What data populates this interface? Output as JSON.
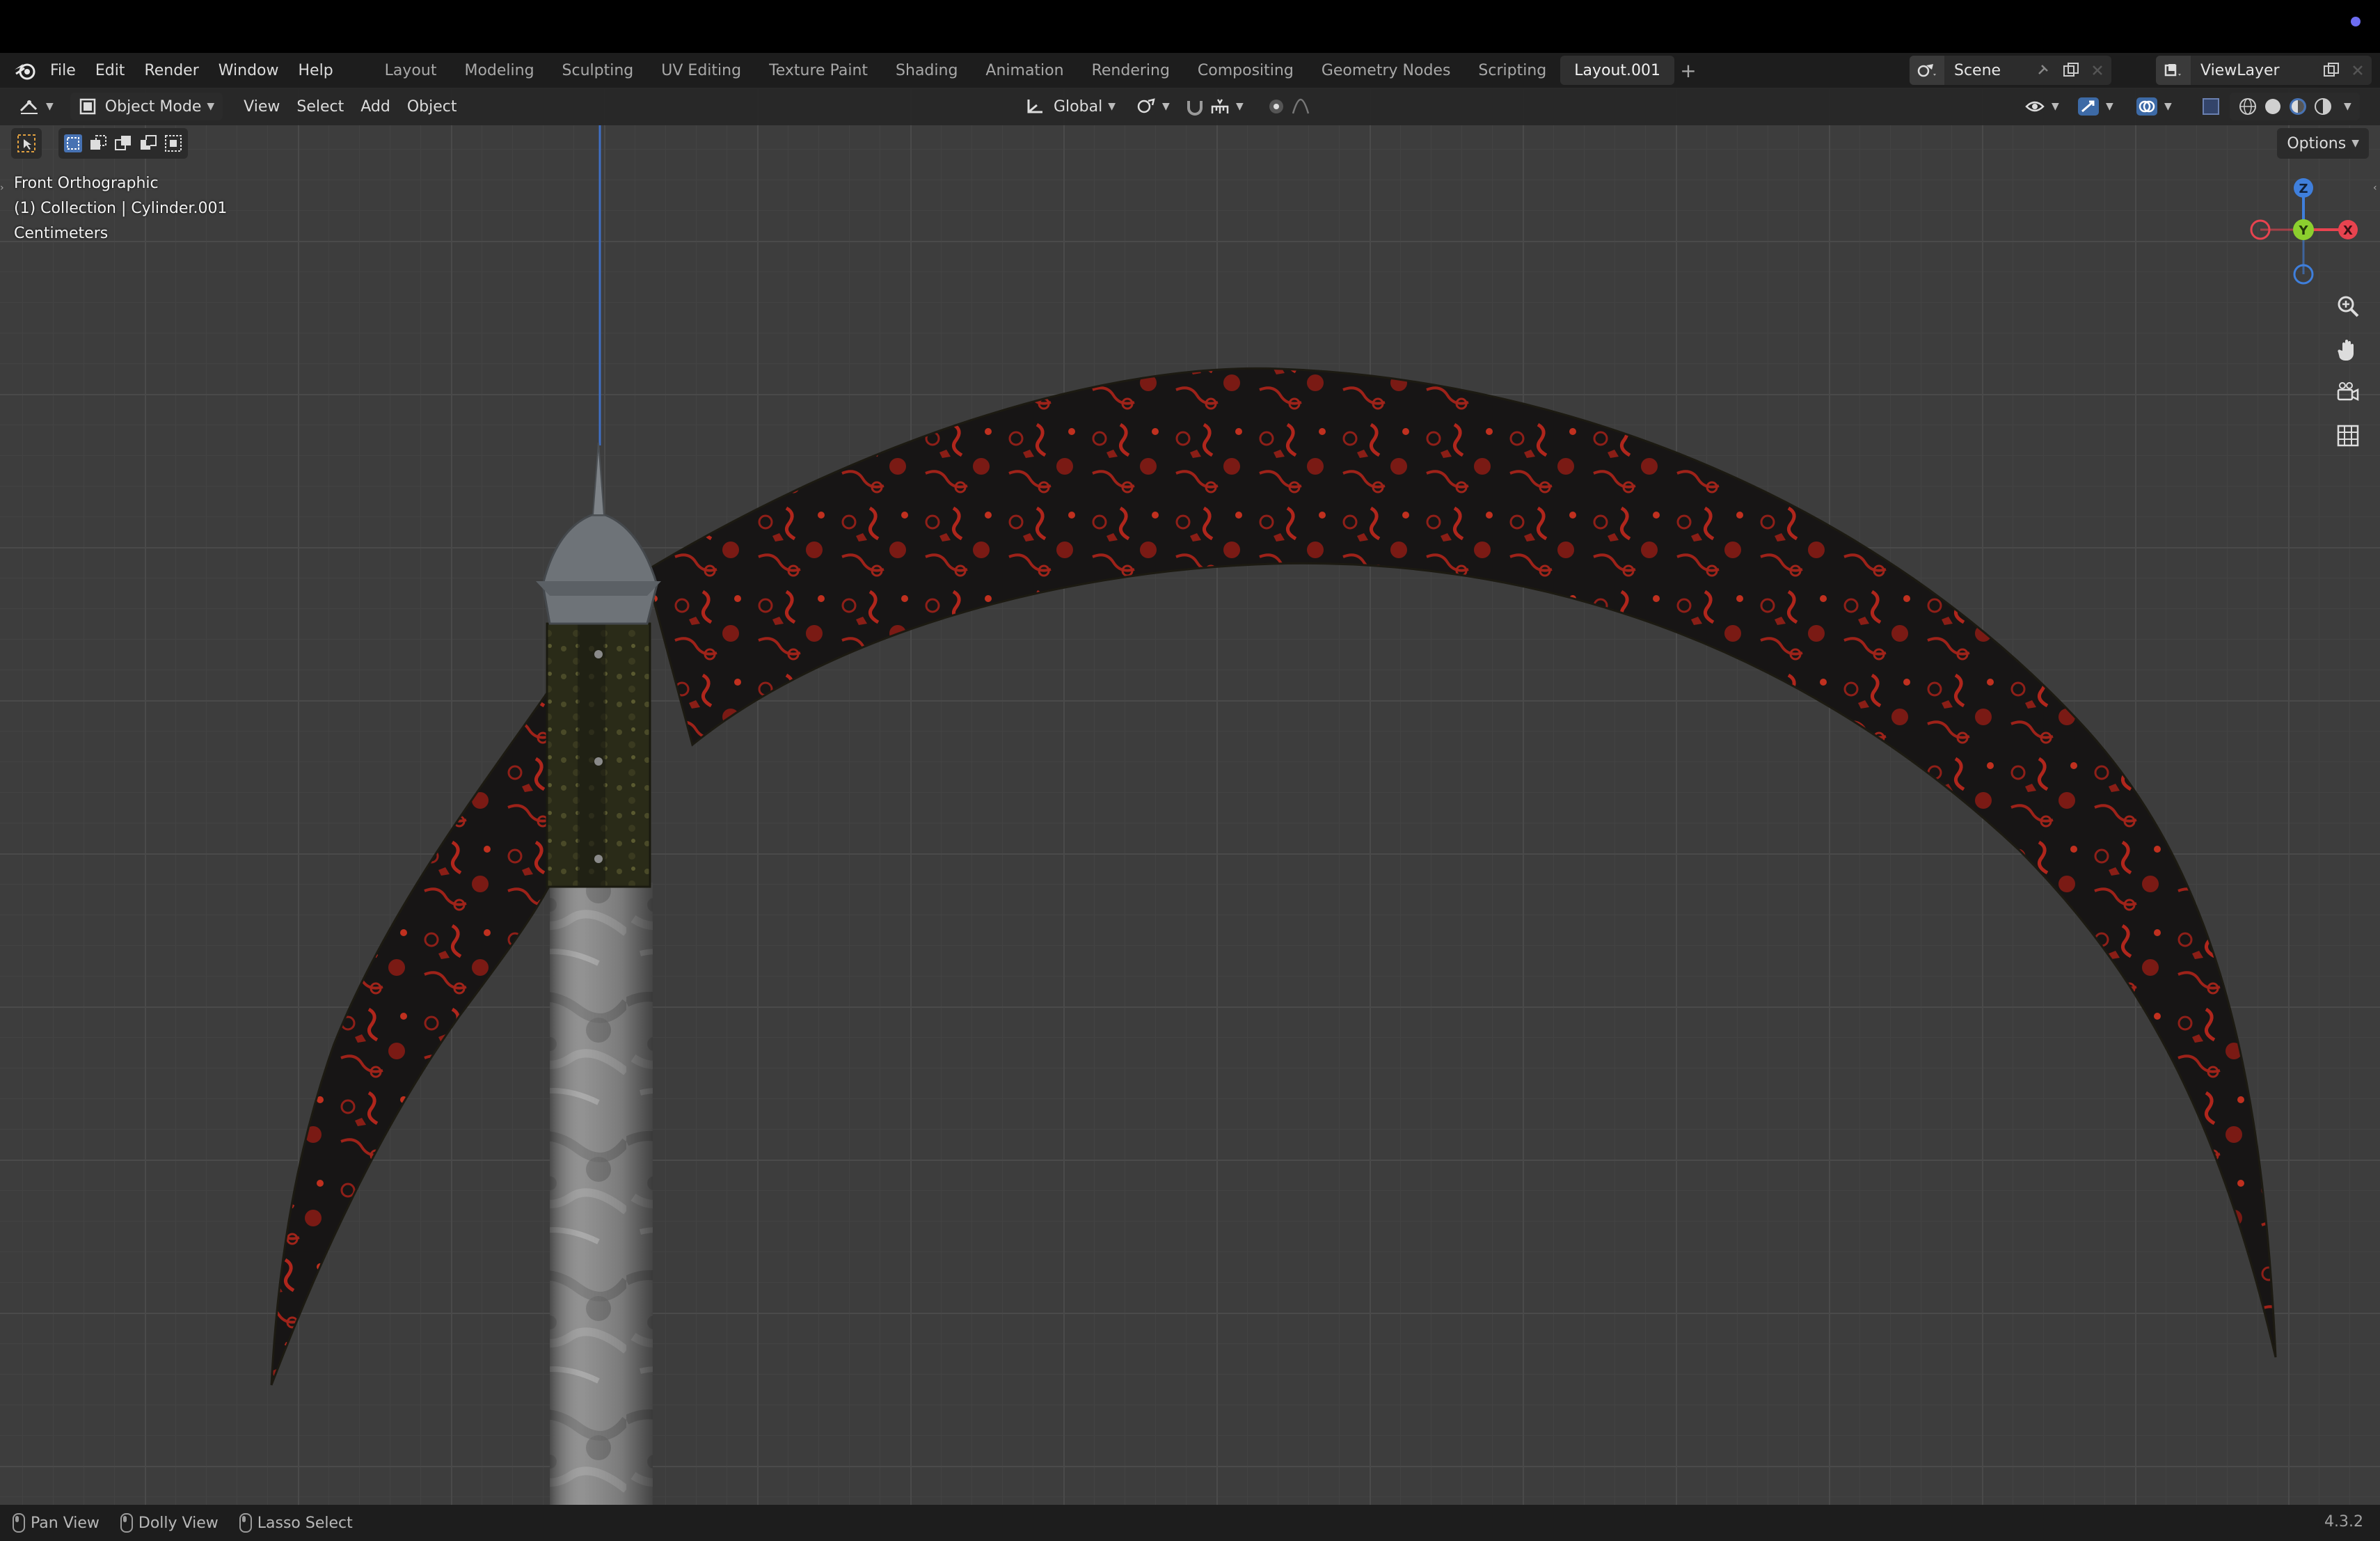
{
  "menu": {
    "file": "File",
    "edit": "Edit",
    "render": "Render",
    "window": "Window",
    "help": "Help"
  },
  "workspaces": [
    "Layout",
    "Modeling",
    "Sculpting",
    "UV Editing",
    "Texture Paint",
    "Shading",
    "Animation",
    "Rendering",
    "Compositing",
    "Geometry Nodes",
    "Scripting",
    "Layout.001"
  ],
  "active_workspace": "Layout.001",
  "scene": {
    "name": "Scene"
  },
  "view_layer": {
    "name": "ViewLayer"
  },
  "header": {
    "mode": "Object Mode",
    "view": "View",
    "select": "Select",
    "add": "Add",
    "object": "Object",
    "transform_orientation": "Global"
  },
  "options_label": "Options",
  "viewport_info": {
    "view_name": "Front Orthographic",
    "collection": "(1) Collection | Cylinder.001",
    "units": "Centimeters"
  },
  "gizmo": {
    "z": "Z",
    "y": "Y",
    "x": "X"
  },
  "status": {
    "pan": "Pan View",
    "dolly": "Dolly View",
    "lasso": "Lasso Select",
    "version": "4.3.2"
  },
  "colors": {
    "axis_x": "#e8434f",
    "axis_y": "#8ccf2e",
    "axis_z": "#3f7fdc",
    "blade_dark": "#161414",
    "blade_red": "#b0261c",
    "shaft": "#8a8a8a"
  }
}
